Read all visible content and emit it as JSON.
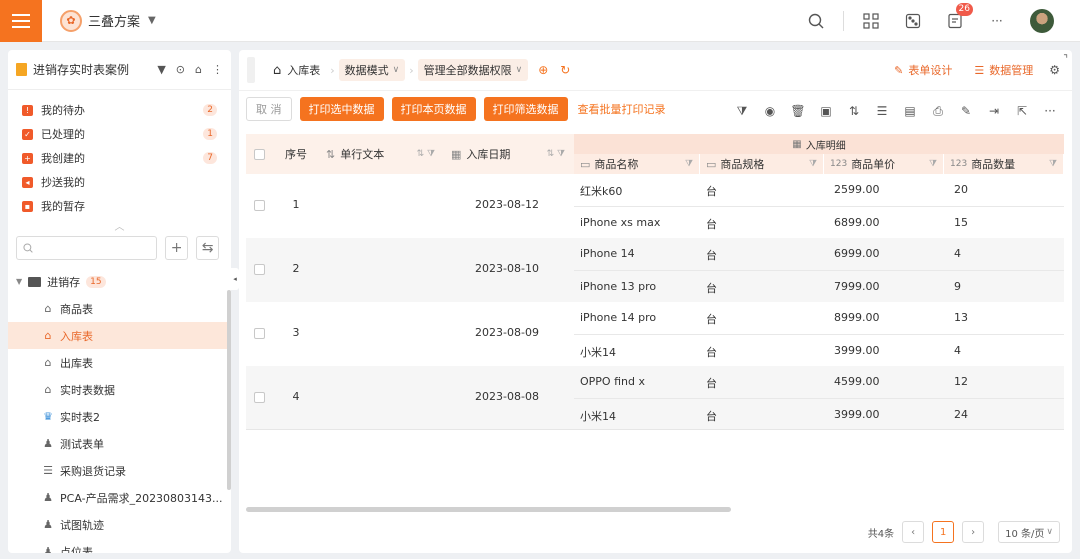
{
  "topbar": {
    "brand_name": "三叠方案",
    "notification_count": "26"
  },
  "sidebar": {
    "title": "进销存实时表案例",
    "tasks": [
      {
        "label": "我的待办",
        "count": "2"
      },
      {
        "label": "已处理的",
        "count": "1"
      },
      {
        "label": "我创建的",
        "count": "7"
      },
      {
        "label": "抄送我的",
        "count": ""
      },
      {
        "label": "我的暂存",
        "count": ""
      }
    ],
    "search_placeholder": "",
    "root": {
      "label": "进销存",
      "count": "15"
    },
    "items": [
      {
        "label": "商品表"
      },
      {
        "label": "入库表"
      },
      {
        "label": "出库表"
      },
      {
        "label": "实时表数据"
      },
      {
        "label": "实时表2"
      },
      {
        "label": "测试表单"
      },
      {
        "label": "采购退货记录"
      },
      {
        "label": "PCA-产品需求_20230803143..."
      },
      {
        "label": "试图轨迹"
      },
      {
        "label": "点位表"
      }
    ]
  },
  "breadcrumb": {
    "home": "入库表",
    "mode": "数据模式",
    "permission": "管理全部数据权限",
    "form_design": "表单设计",
    "data_manage": "数据管理"
  },
  "toolbar": {
    "cancel": "取 消",
    "print_selected": "打印选中数据",
    "print_page": "打印本页数据",
    "print_filtered": "打印筛选数据",
    "print_log": "查看批量打印记录"
  },
  "table": {
    "headers": {
      "seq": "序号",
      "text": "单行文本",
      "date": "入库日期",
      "group": "入库明细",
      "name": "商品名称",
      "spec": "商品规格",
      "price": "商品单价",
      "qty": "商品数量"
    },
    "rows": [
      {
        "seq": "1",
        "text": "",
        "date": "2023-08-12",
        "items": [
          {
            "name": "红米k60",
            "spec": "台",
            "price": "2599.00",
            "qty": "20"
          },
          {
            "name": "iPhone xs max",
            "spec": "台",
            "price": "6899.00",
            "qty": "15"
          }
        ]
      },
      {
        "seq": "2",
        "text": "",
        "date": "2023-08-10",
        "items": [
          {
            "name": "iPhone 14",
            "spec": "台",
            "price": "6999.00",
            "qty": "4"
          },
          {
            "name": "iPhone 13 pro",
            "spec": "台",
            "price": "7999.00",
            "qty": "9"
          }
        ]
      },
      {
        "seq": "3",
        "text": "",
        "date": "2023-08-09",
        "items": [
          {
            "name": "iPhone 14 pro",
            "spec": "台",
            "price": "8999.00",
            "qty": "13"
          },
          {
            "name": "小米14",
            "spec": "台",
            "price": "3999.00",
            "qty": "4"
          }
        ]
      },
      {
        "seq": "4",
        "text": "",
        "date": "2023-08-08",
        "items": [
          {
            "name": "OPPO find x",
            "spec": "台",
            "price": "4599.00",
            "qty": "12"
          },
          {
            "name": "小米14",
            "spec": "台",
            "price": "3999.00",
            "qty": "24"
          }
        ]
      }
    ]
  },
  "pager": {
    "total": "共4条",
    "current": "1",
    "page_size": "10 条/页"
  },
  "colors": {
    "accent": "#f5731f",
    "header_bg": "#fdf1ea",
    "active_bg": "#fde7da"
  }
}
